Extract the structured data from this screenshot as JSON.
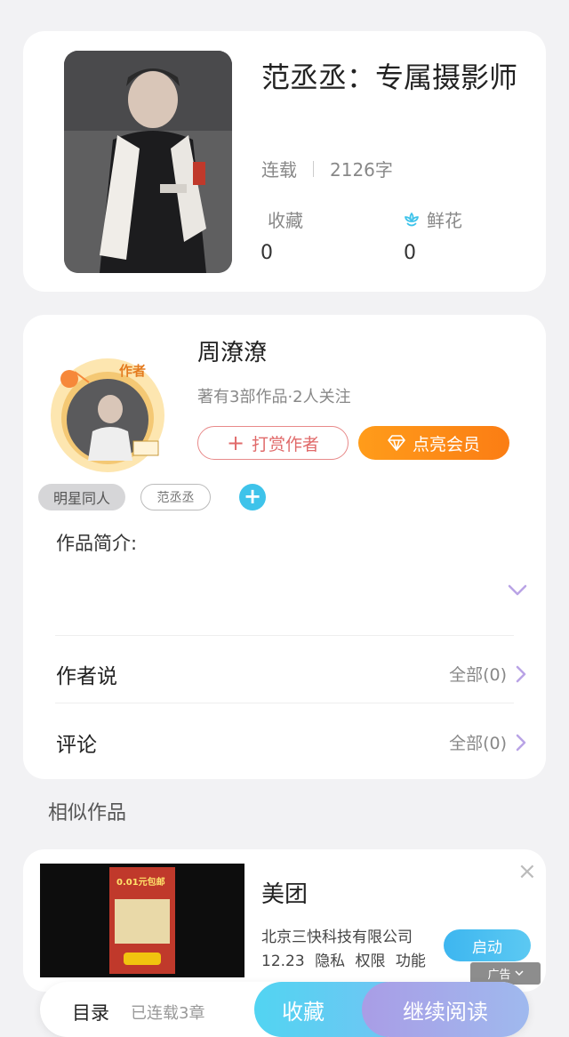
{
  "book": {
    "title": "范丞丞：专属摄影师",
    "status": "连载",
    "word_count": "2126字",
    "stats": [
      {
        "label": "收藏",
        "value": "0"
      },
      {
        "label": "鲜花",
        "value": "0"
      }
    ]
  },
  "author": {
    "name": "周潦潦",
    "info": "著有3部作品·2人关注",
    "avatar_badge": "作者",
    "tip_button": "打赏作者",
    "vip_button": "点亮会员",
    "tags": [
      "明星同人",
      "范丞丞"
    ],
    "add_tag": "+"
  },
  "intro": {
    "label": "作品简介:"
  },
  "author_says": {
    "label": "作者说",
    "right": "全部(0)"
  },
  "comments": {
    "label": "评论",
    "right": "全部(0)"
  },
  "similar": {
    "title": "相似作品"
  },
  "ad": {
    "title": "美团",
    "company": "北京三快科技有限公司",
    "links": "12.23 隐私 权限 功能",
    "button": "启动",
    "badge": "广告",
    "image_text": "0.01元包邮",
    "close": "×"
  },
  "bottom_bar": {
    "toc": "目录",
    "chapters": "已连载3章",
    "collect": "收藏",
    "continue": "继续阅读"
  },
  "colors": {
    "accent_blue": "#3ec3ea",
    "vip_orange": "#fb7d14",
    "tip_red": "#e06a6a",
    "chevron_purple": "#b9a3e6"
  },
  "icons": [
    "flower-icon",
    "plus-icon",
    "diamond-icon",
    "chevron-down-icon",
    "chevron-right-icon",
    "close-icon"
  ]
}
